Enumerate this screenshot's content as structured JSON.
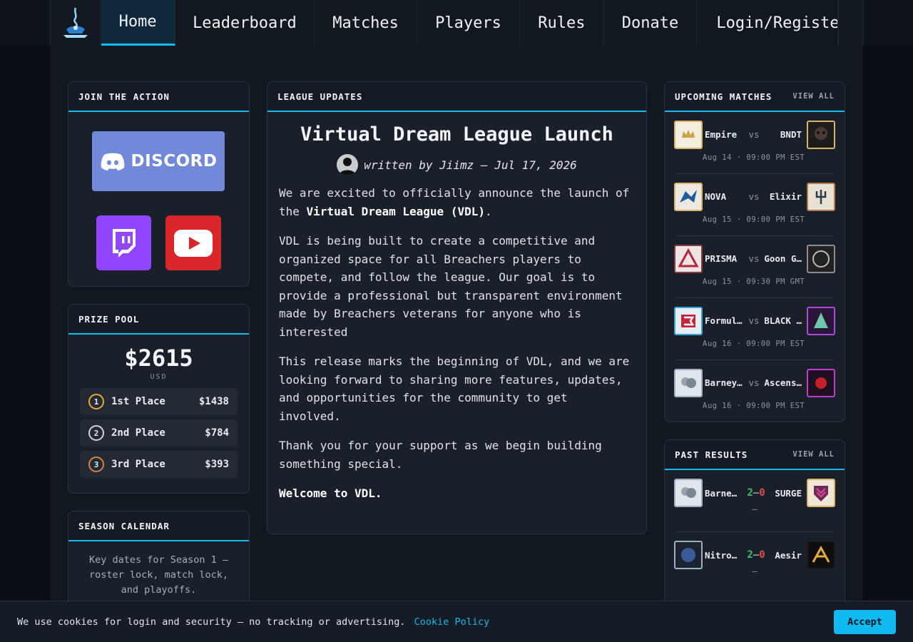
{
  "nav": {
    "items": [
      "Home",
      "Leaderboard",
      "Matches",
      "Players",
      "Rules",
      "Donate",
      "Login/Register"
    ],
    "active": "Home"
  },
  "join": {
    "title": "JOIN THE ACTION",
    "discord_label": "DISCORD"
  },
  "prize": {
    "title": "PRIZE POOL",
    "amount": "$2615",
    "currency": "USD",
    "places": [
      {
        "rank": "1",
        "label": "1st Place",
        "amount": "$1438",
        "color": "#e6a93c"
      },
      {
        "rank": "2",
        "label": "2nd Place",
        "amount": "$784",
        "color": "#d0d4d9"
      },
      {
        "rank": "3",
        "label": "3rd Place",
        "amount": "$393",
        "color": "#d2844a"
      }
    ]
  },
  "calendar": {
    "title": "SEASON CALENDAR",
    "text": "Key dates for Season 1 — roster lock, match lock, and playoffs."
  },
  "updates": {
    "title": "LEAGUE UPDATES",
    "post_title": "Virtual Dream League Launch",
    "author": "written by Jiimz — Jul 17, 2026",
    "p1_pre": "We are excited to officially announce the launch of the ",
    "p1_bold": "Virtual Dream League (VDL)",
    "p1_post": ".",
    "p2": "VDL is being built to create a competitive and organized space for all Breachers players to compete, and follow the league. Our goal is to provide a professional but transparent environment made by Breachers veterans for anyone who is interested",
    "p3": "This release marks the beginning of VDL, and we are looking forward to sharing more features, updates, and opportunities for the community to get involved.",
    "p4": "Thank you for your support as we begin building something special.",
    "p5": "Welcome to VDL."
  },
  "upcoming": {
    "title": "UPCOMING MATCHES",
    "view_all": "VIEW ALL",
    "vs": "vs",
    "matches": [
      {
        "a": "Empire",
        "b": "BNDT",
        "date": "Aug 14 · 09:00 PM EST"
      },
      {
        "a": "NOVA",
        "b": "Elixir",
        "date": "Aug 15 · 09:00 PM EST"
      },
      {
        "a": "PRISMA",
        "b": "Goon G…",
        "date": "Aug 15 · 09:30 PM GMT"
      },
      {
        "a": "Formul…",
        "b": "BLACK …",
        "date": "Aug 16 · 09:00 PM EST"
      },
      {
        "a": "Barney…",
        "b": "Ascens…",
        "date": "Aug 16 · 09:00 PM EST"
      }
    ]
  },
  "past": {
    "title": "PAST RESULTS",
    "view_all": "VIEW ALL",
    "dash": "—",
    "results": [
      {
        "a": "Barne…",
        "b": "SURGE",
        "sa": "2",
        "sb": "0"
      },
      {
        "a": "Nitro…",
        "b": "Aesir",
        "sa": "2",
        "sb": "0"
      }
    ]
  },
  "cookie": {
    "text": "We use cookies for login and security — no tracking or advertising.",
    "link": "Cookie Policy",
    "accept": "Accept"
  }
}
